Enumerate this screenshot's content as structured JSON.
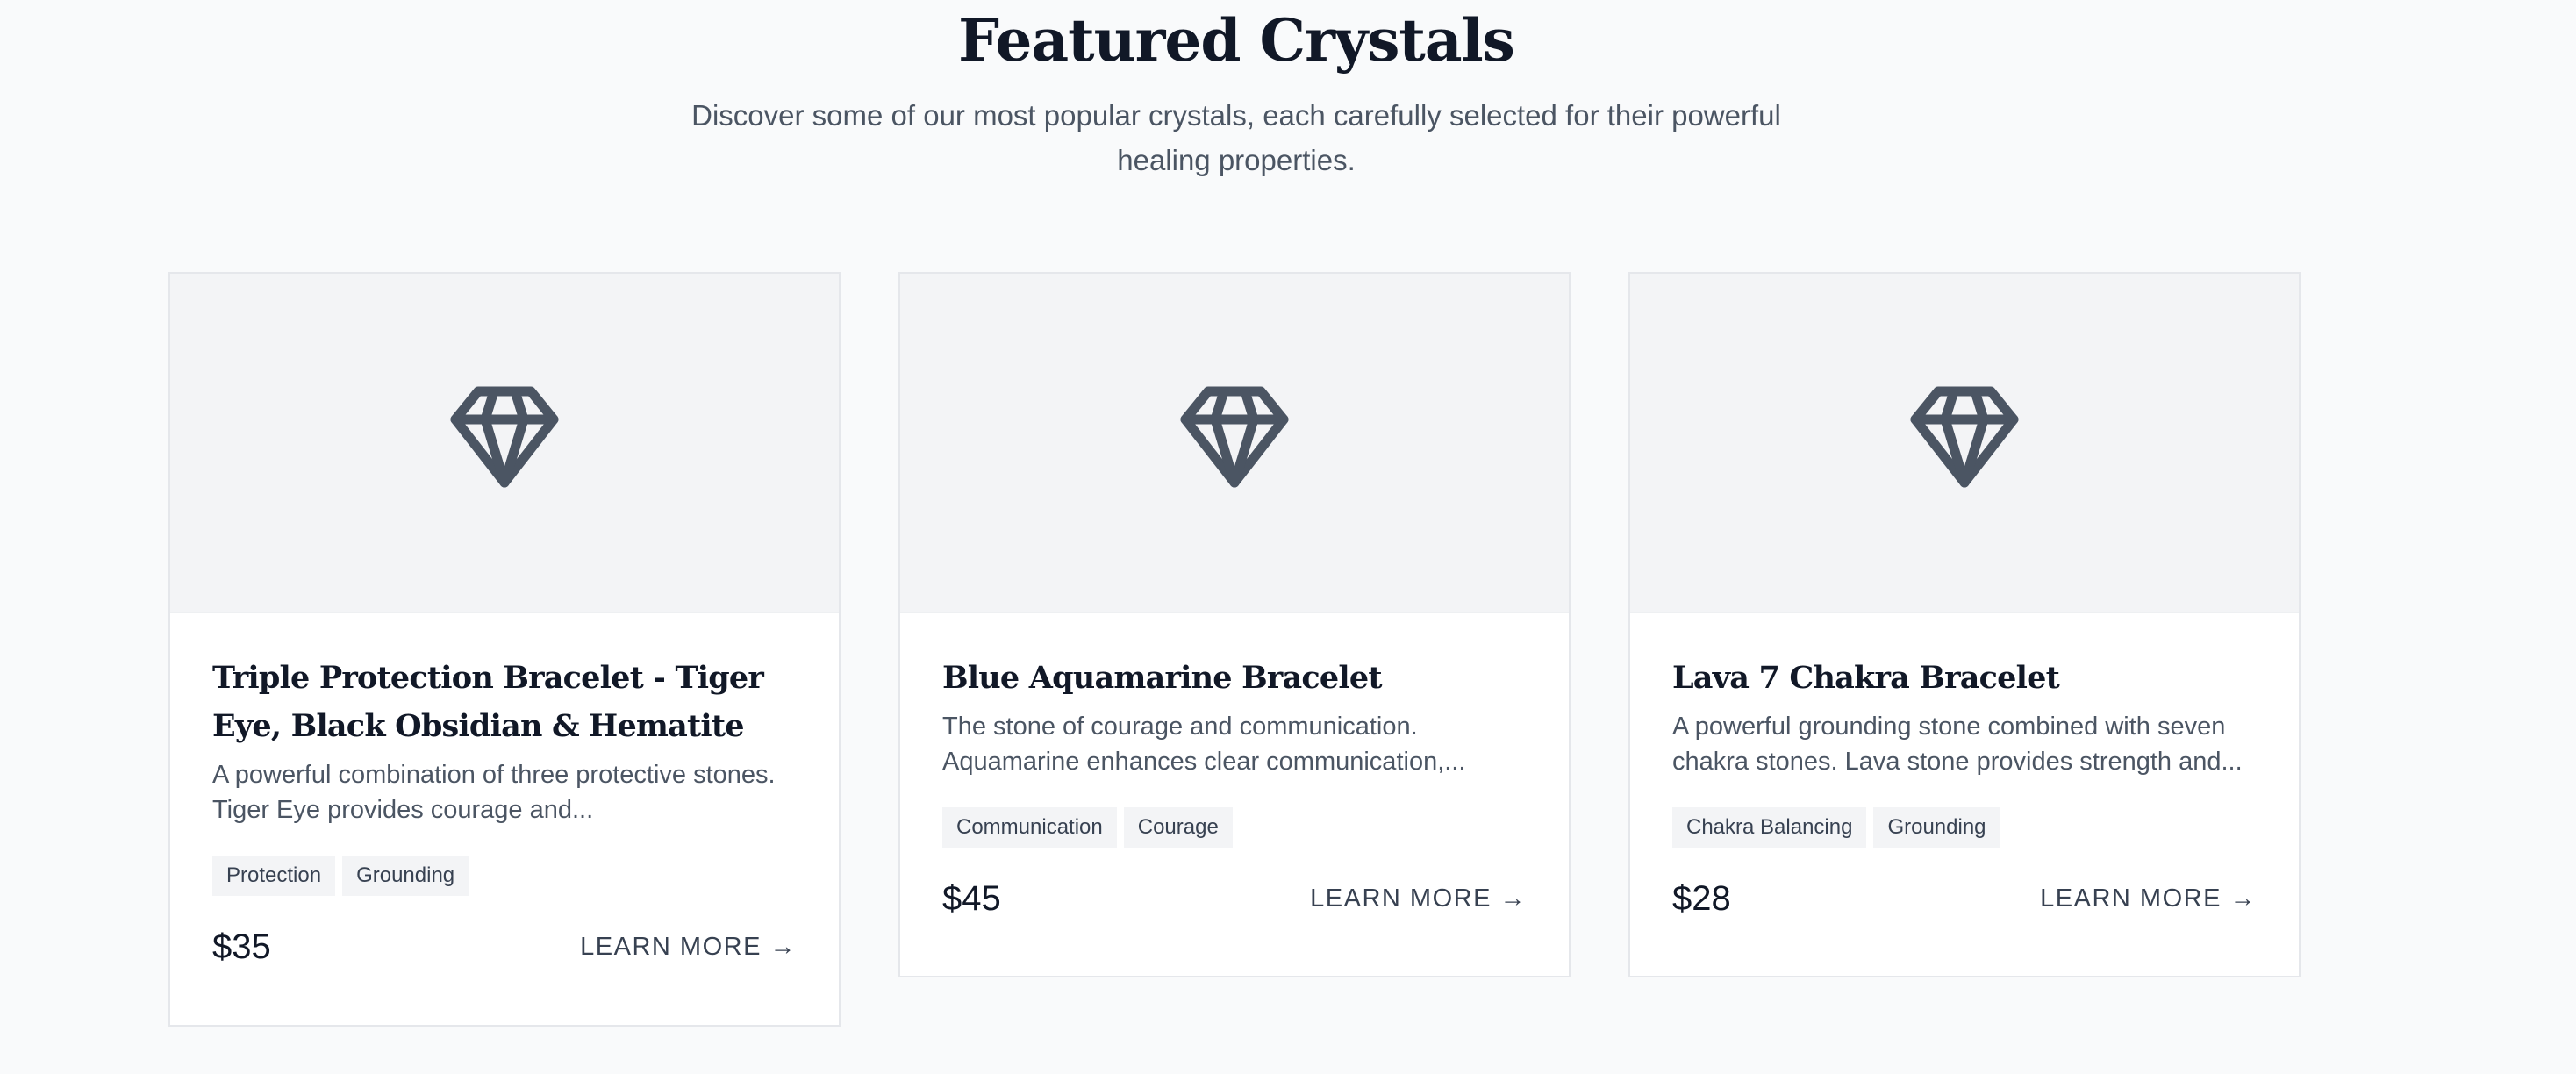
{
  "header": {
    "title": "Featured Crystals",
    "subtitle": "Discover some of our most popular crystals, each carefully selected for their powerful healing properties."
  },
  "colors": {
    "background": "#f9fafb",
    "card_image_bg": "#f3f4f6",
    "icon": "#4b5563",
    "tag_bg": "#f3f4f6",
    "heading": "#111827",
    "body_text": "#4b5563"
  },
  "cards": [
    {
      "icon": "gem-icon",
      "title": "Triple Protection Bracelet - Tiger Eye, Black Obsidian & Hematite",
      "description": "A powerful combination of three protective stones. Tiger Eye provides courage and...",
      "tags": [
        "Protection",
        "Grounding"
      ],
      "price": "$35",
      "cta": "LEARN MORE →"
    },
    {
      "icon": "gem-icon",
      "title": "Blue Aquamarine Bracelet",
      "description": "The stone of courage and communication. Aquamarine enhances clear communication,...",
      "tags": [
        "Communication",
        "Courage"
      ],
      "price": "$45",
      "cta": "LEARN MORE →"
    },
    {
      "icon": "gem-icon",
      "title": "Lava 7 Chakra Bracelet",
      "description": "A powerful grounding stone combined with seven chakra stones. Lava stone provides strength and...",
      "tags": [
        "Chakra Balancing",
        "Grounding"
      ],
      "price": "$28",
      "cta": "LEARN MORE →"
    }
  ]
}
